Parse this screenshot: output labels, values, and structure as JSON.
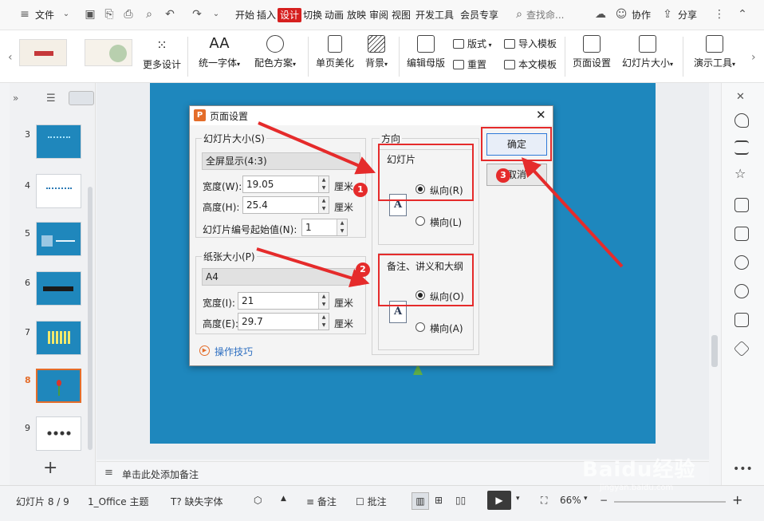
{
  "menubar": {
    "file": "文件",
    "tabs": [
      "开始",
      "插入",
      "设计",
      "切换",
      "动画",
      "放映",
      "审阅",
      "视图",
      "开发工具",
      "会员专享"
    ],
    "active_tab": "设计",
    "search": "查找命...",
    "collab": "协作",
    "share": "分享"
  },
  "ribbon": {
    "more_design": "更多设计",
    "unify_font": "统一字体",
    "color_scheme": "配色方案",
    "page_beautify": "单页美化",
    "background": "背景",
    "edit_master": "编辑母版",
    "layout": "版式",
    "reset": "重置",
    "import_template": "导入模板",
    "this_template": "本文模板",
    "page_setup": "页面设置",
    "slide_size": "幻灯片大小",
    "present_tools": "演示工具"
  },
  "slides": {
    "numbers": [
      "3",
      "4",
      "5",
      "6",
      "7",
      "8",
      "9"
    ],
    "selected": "8",
    "add": "+"
  },
  "notes": {
    "placeholder": "单击此处添加备注"
  },
  "status": {
    "slide_count": "幻灯片 8 / 9",
    "theme": "1_Office 主题",
    "missing_font": "缺失字体",
    "notes": "备注",
    "comment": "批注",
    "zoom": "66%"
  },
  "dialog": {
    "title": "页面设置",
    "slide_size_group": "幻灯片大小(S)",
    "slide_size_value": "全屏显示(4:3)",
    "width_label": "宽度(W):",
    "width_value": "19.05",
    "height_label": "高度(H):",
    "height_value": "25.4",
    "unit": "厘米",
    "start_num_label": "幻灯片编号起始值(N):",
    "start_num_value": "1",
    "paper_group": "纸张大小(P)",
    "paper_value": "A4",
    "paper_width_label": "宽度(I):",
    "paper_width_value": "21",
    "paper_height_label": "高度(E):",
    "paper_height_value": "29.7",
    "tips": "操作技巧",
    "orientation": "方向",
    "slides_group": "幻灯片",
    "portrait_r": "纵向(R)",
    "landscape_l": "横向(L)",
    "notes_group": "备注、讲义和大纲",
    "portrait_o": "纵向(O)",
    "landscape_a": "横向(A)",
    "ok": "确定",
    "cancel": "取消"
  },
  "annotations": {
    "badge1": "1",
    "badge2": "2",
    "badge3": "3"
  },
  "colors": {
    "accent": "#d6201f",
    "slide_bg": "#1e87bd",
    "annotation": "#e52b2b"
  },
  "watermark": "Baidu经验 jingyan.baidu.com"
}
